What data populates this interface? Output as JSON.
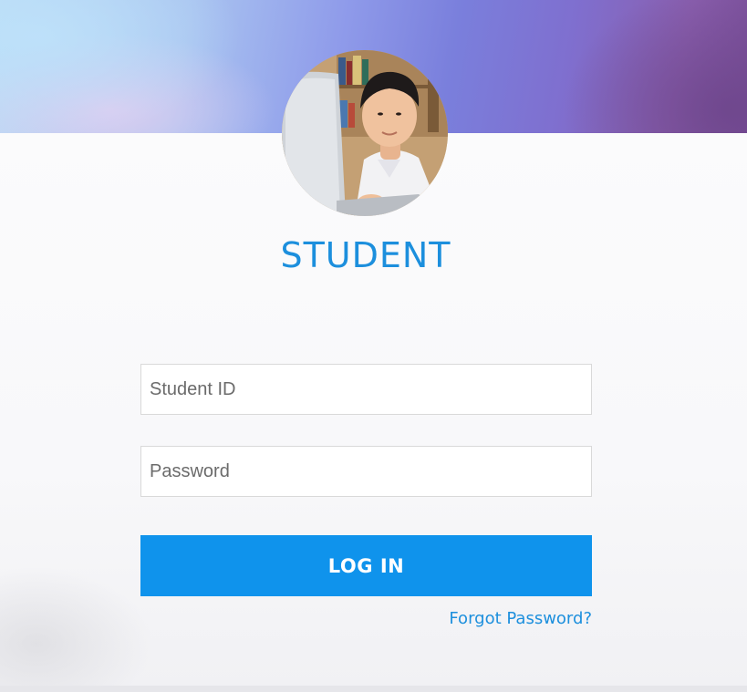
{
  "header": {
    "role_title": "STUDENT"
  },
  "form": {
    "student_id": {
      "value": "",
      "placeholder": "Student ID"
    },
    "password": {
      "value": "",
      "placeholder": "Password"
    },
    "login_label": "LOG IN",
    "forgot_label": "Forgot Password?"
  },
  "colors": {
    "accent": "#1c8fdd",
    "button": "#0f93ec"
  }
}
